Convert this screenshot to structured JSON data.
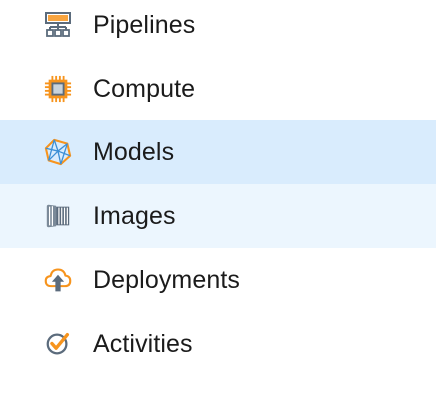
{
  "nav": {
    "items": [
      {
        "label": "Pipelines",
        "icon": "pipelines-icon"
      },
      {
        "label": "Compute",
        "icon": "compute-icon"
      },
      {
        "label": "Models",
        "icon": "models-icon",
        "state": "selected"
      },
      {
        "label": "Images",
        "icon": "images-icon",
        "state": "hover"
      },
      {
        "label": "Deployments",
        "icon": "deployments-icon"
      },
      {
        "label": "Activities",
        "icon": "activities-icon"
      }
    ]
  },
  "colors": {
    "selected_bg": "#d9ecfd",
    "hover_bg": "#ecf6fe",
    "icon_gray": "#5b6b7c",
    "icon_orange": "#f7941d",
    "icon_blue": "#3c8fd6",
    "text": "#1b1b1b"
  }
}
